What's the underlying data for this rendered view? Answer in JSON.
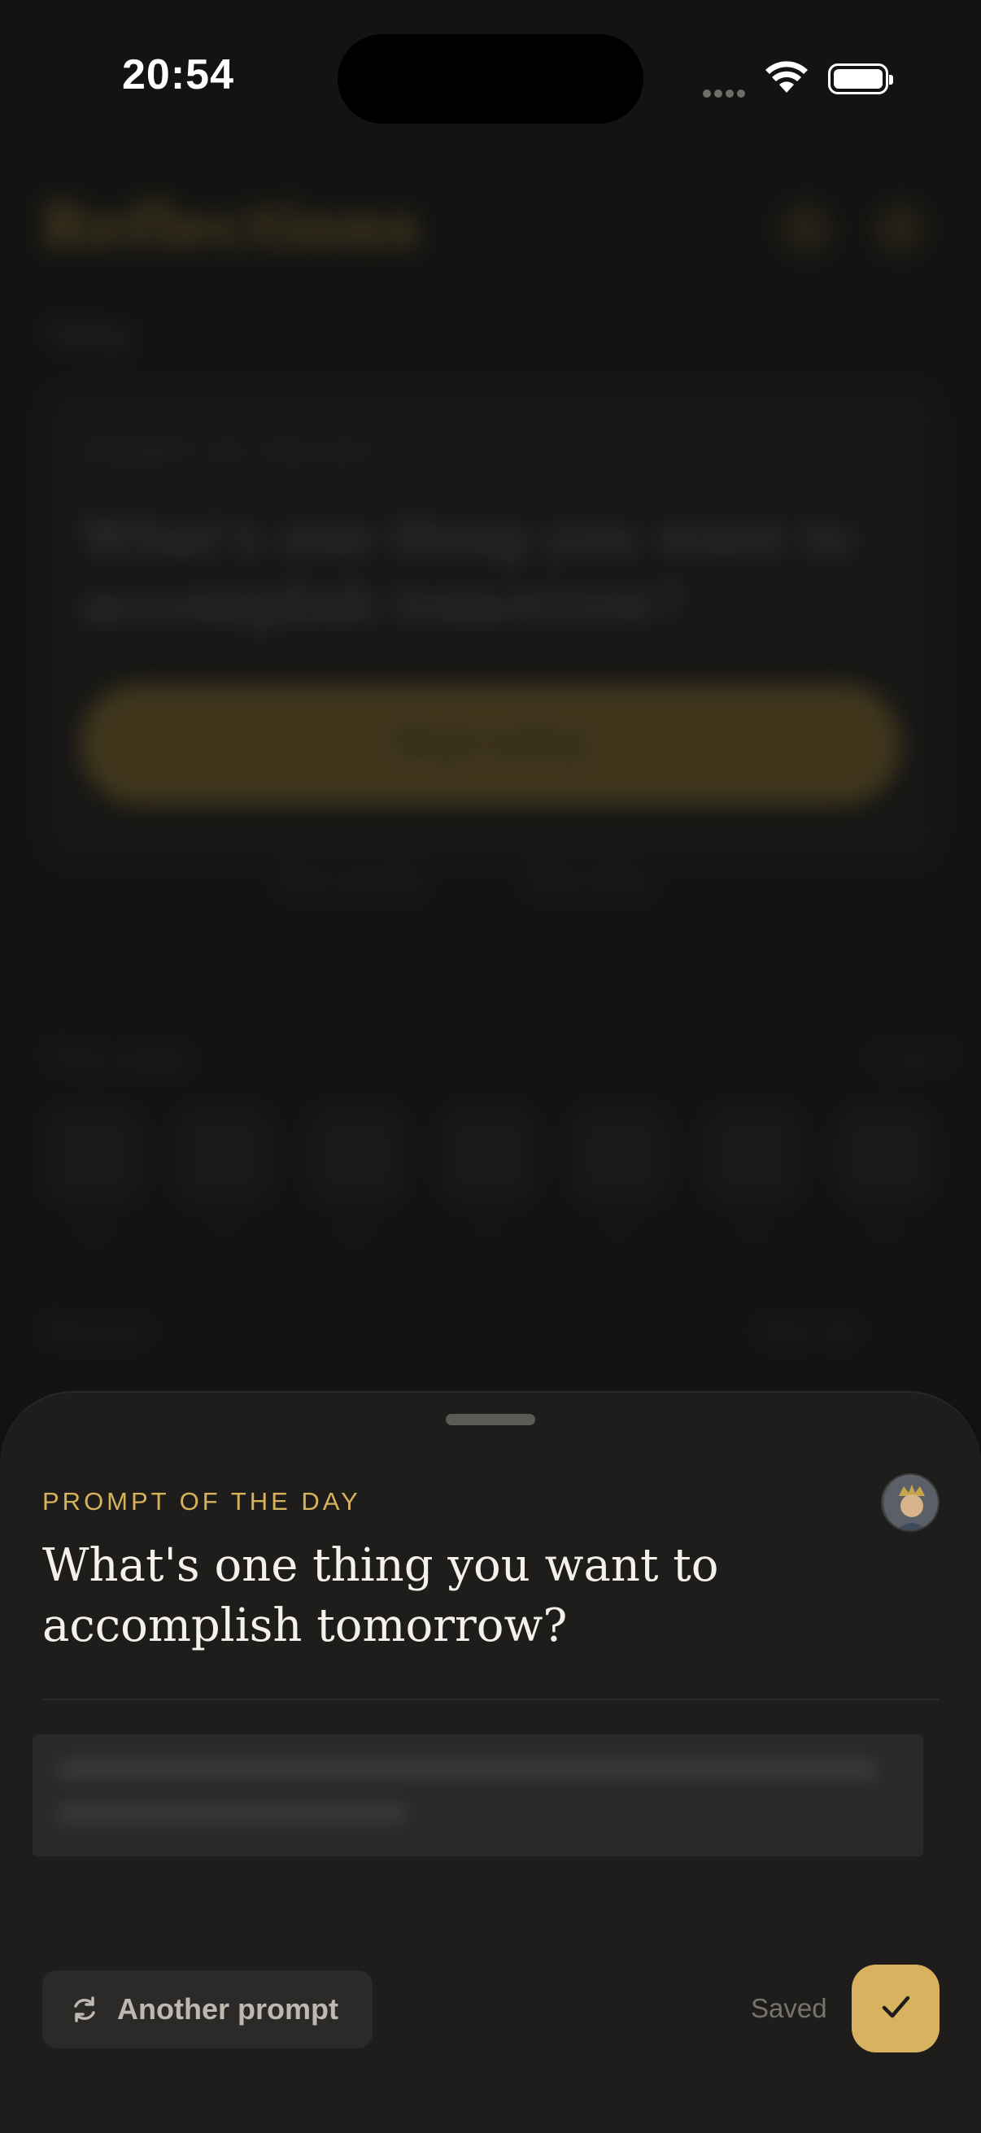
{
  "status_bar": {
    "time": "20:54"
  },
  "background_app": {
    "title": "Reflections",
    "date": "Today",
    "card_label": "PROMPT OF THE DAY",
    "card_question": "What's one thing you want to accomplish tomorrow?",
    "cta_label": "Begin writing",
    "link_left": "New prompt",
    "link_right": "Skip today",
    "section_title": "This week",
    "section_right": "0 of 7",
    "days": [
      "M",
      "T",
      "W",
      "T",
      "F",
      "S",
      "S"
    ],
    "bottom_left": "Recent",
    "bottom_right": "See all"
  },
  "sheet": {
    "label": "PROMPT OF THE DAY",
    "question": "What's one thing you want to accomplish tomorrow?",
    "another_prompt_label": "Another prompt",
    "saved_label": "Saved"
  },
  "icons": {
    "refresh": "refresh-icon",
    "check": "check-icon",
    "wifi": "wifi-icon",
    "battery": "battery-icon",
    "avatar": "user-avatar"
  },
  "colors": {
    "accent": "#d9b25f",
    "sheet_bg": "#1e1d1c",
    "label": "#d6b25b"
  }
}
